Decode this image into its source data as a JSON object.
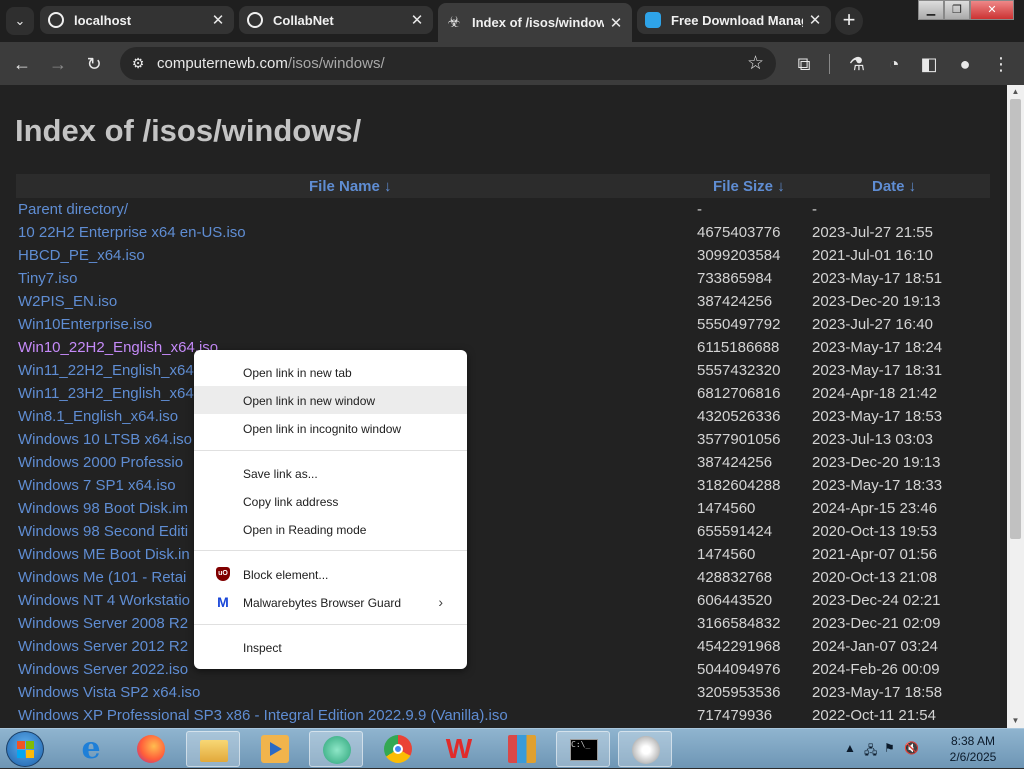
{
  "tabs": [
    {
      "label": "localhost",
      "close": "✕"
    },
    {
      "label": "CollabNet",
      "close": "✕"
    },
    {
      "label": "Index of /isos/windows/",
      "close": "✕",
      "active": true
    },
    {
      "label": "Free Download Manager",
      "close": "✕"
    }
  ],
  "toolbar": {
    "url_domain": "computernewb.com",
    "url_path": "/isos/windows/"
  },
  "page": {
    "title": "Index of /isos/windows/",
    "columns": {
      "name": "File Name  ↓",
      "size": "File Size  ↓",
      "date": "Date  ↓"
    },
    "rows": [
      {
        "name": "Parent directory/",
        "size": "-",
        "date": "-"
      },
      {
        "name": "10 22H2 Enterprise x64 en-US.iso",
        "size": "4675403776",
        "date": "2023-Jul-27 21:55"
      },
      {
        "name": "HBCD_PE_x64.iso",
        "size": "3099203584",
        "date": "2021-Jul-01 16:10"
      },
      {
        "name": "Tiny7.iso",
        "size": "733865984",
        "date": "2023-May-17 18:51"
      },
      {
        "name": "W2PIS_EN.iso",
        "size": "387424256",
        "date": "2023-Dec-20 19:13"
      },
      {
        "name": "Win10Enterprise.iso",
        "size": "5550497792",
        "date": "2023-Jul-27 16:40"
      },
      {
        "name": "Win10_22H2_English_x64.iso",
        "size": "6115186688",
        "date": "2023-May-17 18:24",
        "visited": true
      },
      {
        "name": "Win11_22H2_English_x64",
        "size": "5557432320",
        "date": "2023-May-17 18:31"
      },
      {
        "name": "Win11_23H2_English_x64",
        "size": "6812706816",
        "date": "2024-Apr-18 21:42"
      },
      {
        "name": "Win8.1_English_x64.iso",
        "size": "4320526336",
        "date": "2023-May-17 18:53"
      },
      {
        "name": "Windows 10 LTSB x64.iso",
        "size": "3577901056",
        "date": "2023-Jul-13 03:03"
      },
      {
        "name": "Windows 2000 Professio",
        "size": "387424256",
        "date": "2023-Dec-20 19:13"
      },
      {
        "name": "Windows 7 SP1 x64.iso",
        "size": "3182604288",
        "date": "2023-May-17 18:33"
      },
      {
        "name": "Windows 98 Boot Disk.im",
        "size": "1474560",
        "date": "2024-Apr-15 23:46"
      },
      {
        "name": "Windows 98 Second Editi",
        "size": "655591424",
        "date": "2020-Oct-13 19:53"
      },
      {
        "name": "Windows ME Boot Disk.in",
        "size": "1474560",
        "date": "2021-Apr-07 01:56"
      },
      {
        "name": "Windows Me (101 - Retai",
        "size": "428832768",
        "date": "2020-Oct-13 21:08"
      },
      {
        "name": "Windows NT 4 Workstatio",
        "size": "606443520",
        "date": "2023-Dec-24 02:21"
      },
      {
        "name": "Windows Server 2008 R2",
        "size": "3166584832",
        "date": "2023-Dec-21 02:09"
      },
      {
        "name": "Windows Server 2012 R2",
        "size": "4542291968",
        "date": "2024-Jan-07 03:24"
      },
      {
        "name": "Windows Server 2022.iso",
        "size": "5044094976",
        "date": "2024-Feb-26 00:09"
      },
      {
        "name": "Windows Vista SP2 x64.iso",
        "size": "3205953536",
        "date": "2023-May-17 18:58"
      },
      {
        "name": "Windows XP Professional SP3 x86 - Integral Edition 2022.9.9 (Vanilla).iso",
        "size": "717479936",
        "date": "2022-Oct-11 21:54"
      }
    ]
  },
  "context_menu": {
    "open_new_tab": "Open link in new tab",
    "open_new_window": "Open link in new window",
    "open_incognito": "Open link in incognito window",
    "save_link": "Save link as...",
    "copy_link": "Copy link address",
    "reading_mode": "Open in Reading mode",
    "block_element": "Block element...",
    "block_icon_text": "uO",
    "malwarebytes": "Malwarebytes Browser Guard",
    "malwarebytes_icon_text": "M",
    "inspect": "Inspect"
  },
  "taskbar": {
    "time": "8:38 AM",
    "date": "2/6/2025",
    "apps": [
      "internet-explorer",
      "firefox",
      "file-explorer",
      "media-player",
      "app-green-fish",
      "chrome",
      "wps-office",
      "winrar",
      "command-prompt",
      "backup-tool"
    ]
  },
  "colors": {
    "link": "#5f8dd3",
    "visited_link": "#c58af9",
    "page_bg": "#222222",
    "title": "#c4c4c4"
  }
}
